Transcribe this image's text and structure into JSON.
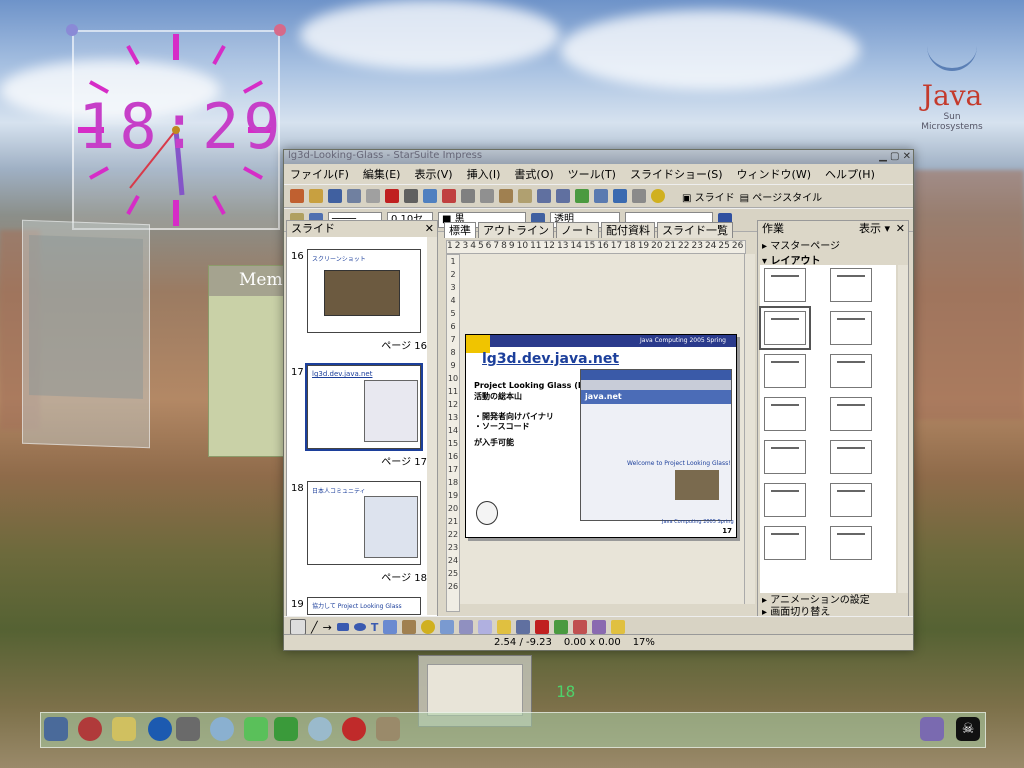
{
  "desktop": {
    "java_logo": {
      "word": "Java",
      "company": "Sun Microsystems"
    },
    "clock": {
      "hours": "18",
      "minutes": "29",
      "separator": ":"
    },
    "memo": {
      "title": "Memo"
    },
    "mini_clock": "18"
  },
  "app": {
    "title": "lg3d-Looking-Glass - StarSuite Impress",
    "menu": [
      "ファイル(F)",
      "編集(E)",
      "表示(V)",
      "挿入(I)",
      "書式(O)",
      "ツール(T)",
      "スライドショー(S)",
      "ウィンドウ(W)",
      "ヘルプ(H)"
    ],
    "toolbar_right": {
      "slide_label": "スライド",
      "page_style_label": "ページスタイル"
    },
    "format_bar": {
      "line_width": "0.10セン",
      "line_color": "黒",
      "fill": "透明"
    },
    "slides_pane": {
      "title": "スライド",
      "items": [
        {
          "number": "16",
          "label": "ページ 16",
          "heading": "スクリーンショット"
        },
        {
          "number": "17",
          "label": "ページ 17",
          "heading": "lg3d.dev.java.net"
        },
        {
          "number": "18",
          "label": "ページ 18",
          "heading": "日本人コミュニティ"
        },
        {
          "number": "19",
          "label": "",
          "heading": "協力して Project Looking Glass"
        }
      ]
    },
    "view_tabs": [
      "標準",
      "アウトライン",
      "ノート",
      "配付資料",
      "スライド一覧"
    ],
    "ruler_marks": [
      "1",
      "2",
      "3",
      "4",
      "5",
      "6",
      "7",
      "8",
      "9",
      "10",
      "11",
      "12",
      "13",
      "14",
      "15",
      "16",
      "17",
      "18",
      "19",
      "20",
      "21",
      "22",
      "23",
      "24",
      "25",
      "26"
    ],
    "slide": {
      "header_text": "Java Computing 2005 Spring",
      "title": "lg3d.dev.java.net",
      "subtitle_line1": "Project Looking Glass (LG3D)",
      "subtitle_line2": "活動の総本山",
      "bullet1": "・開発者向けバイナリ",
      "bullet2": "・ソースコード",
      "bullet3": "が入手可能",
      "footer_text": "Java Computing 2005 Spring",
      "page_number": "17",
      "browser_site": "java.net",
      "browser_heading": "Welcome to Project Looking Glass!"
    },
    "tasks_pane": {
      "title": "作業",
      "view_label": "表示 ▾",
      "section_master": "マスターページ",
      "section_layout": "レイアウト",
      "section_animation": "アニメーションの設定",
      "section_transition": "画面切り替え"
    },
    "statusbar": {
      "position": "2.54 / -9.23",
      "size": "0.00 x 0.00",
      "zoom": "17%"
    }
  },
  "colors": {
    "accent_title": "#1c3f9b",
    "clock_magenta": "#c63fc8",
    "slide_yellow": "#f0c400"
  }
}
